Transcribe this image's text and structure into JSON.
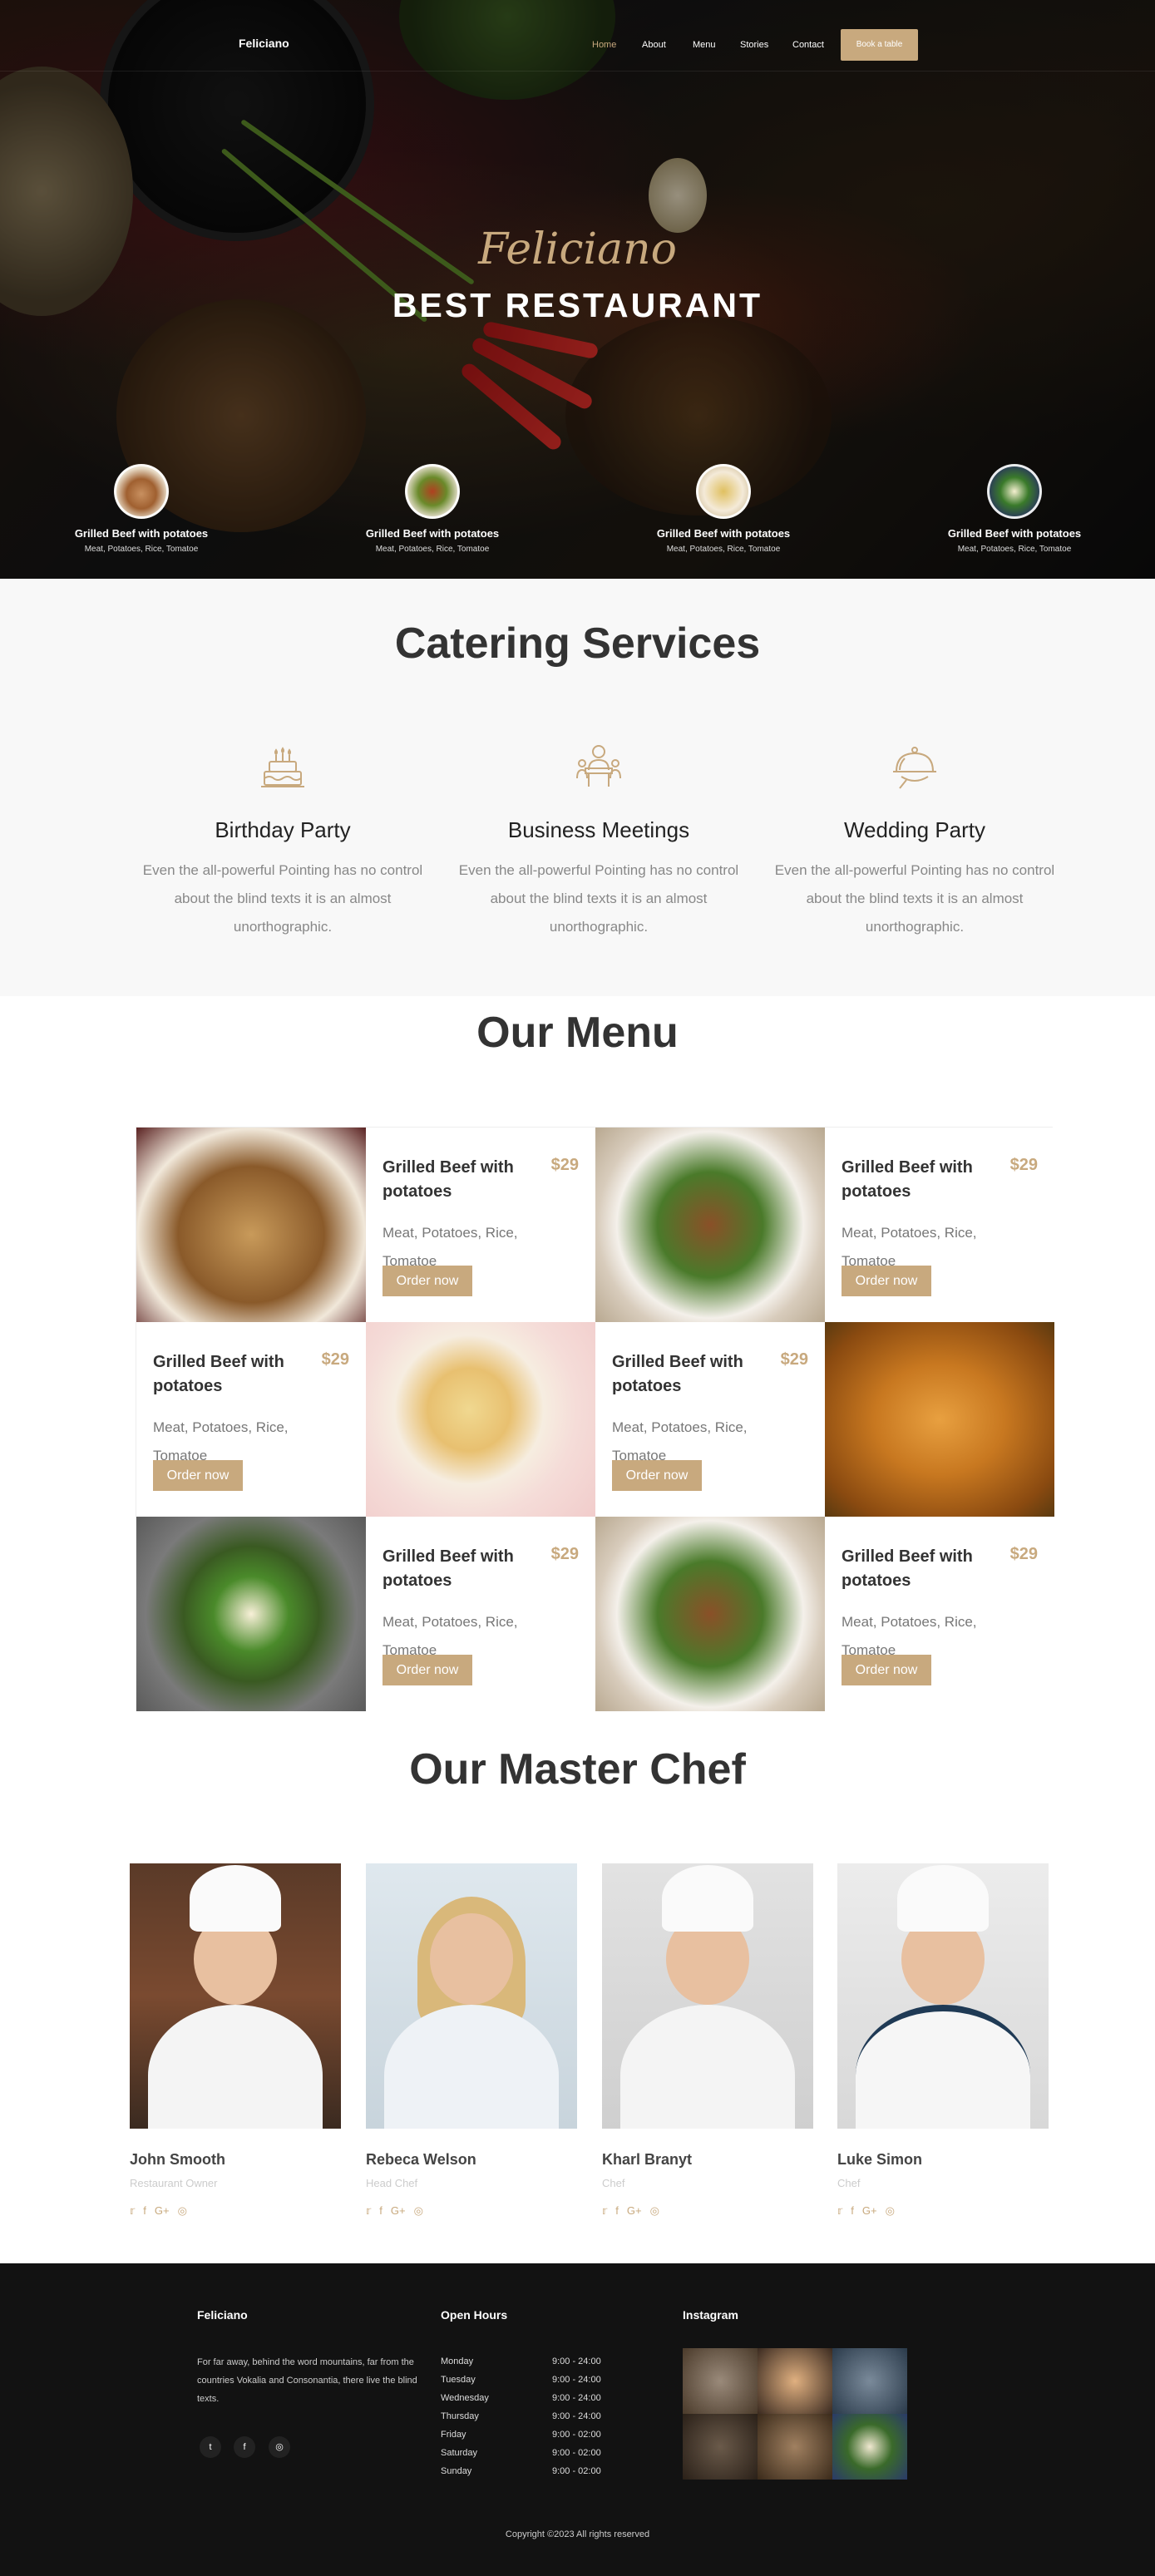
{
  "nav": {
    "brand": "Feliciano",
    "links": [
      "Home",
      "About",
      "Menu",
      "Stories",
      "Contact"
    ],
    "cta": "Book a table"
  },
  "hero": {
    "script": "Feliciano",
    "title": "BEST RESTAURANT",
    "features": [
      {
        "title": "Grilled Beef with potatoes",
        "subtitle": "Meat, Potatoes, Rice, Tomatoe"
      },
      {
        "title": "Grilled Beef with potatoes",
        "subtitle": "Meat, Potatoes, Rice, Tomatoe"
      },
      {
        "title": "Grilled Beef with potatoes",
        "subtitle": "Meat, Potatoes, Rice, Tomatoe"
      },
      {
        "title": "Grilled Beef with potatoes",
        "subtitle": "Meat, Potatoes, Rice, Tomatoe"
      }
    ]
  },
  "catering": {
    "title": "Catering Services",
    "services": [
      {
        "name": "Birthday Party",
        "description": "Even the all-powerful Pointing has no control about the blind texts it is an almost unorthographic.",
        "icon": "birthday-cake-icon"
      },
      {
        "name": "Business Meetings",
        "description": "Even the all-powerful Pointing has no control about the blind texts it is an almost unorthographic.",
        "icon": "meeting-icon"
      },
      {
        "name": "Wedding Party",
        "description": "Even the all-powerful Pointing has no control about the blind texts it is an almost unorthographic.",
        "icon": "serving-dish-icon"
      }
    ]
  },
  "menu": {
    "title": "Our Menu",
    "items": [
      {
        "name": "Grilled Beef with potatoes",
        "price": "$29",
        "description": "Meat, Potatoes, Rice, Tomatoe",
        "button": "Order now"
      },
      {
        "name": "Grilled Beef with potatoes",
        "price": "$29",
        "description": "Meat, Potatoes, Rice, Tomatoe",
        "button": "Order now"
      },
      {
        "name": "Grilled Beef with potatoes",
        "price": "$29",
        "description": "Meat, Potatoes, Rice, Tomatoe",
        "button": "Order now"
      },
      {
        "name": "Grilled Beef with potatoes",
        "price": "$29",
        "description": "Meat, Potatoes, Rice, Tomatoe",
        "button": "Order now"
      },
      {
        "name": "Grilled Beef with potatoes",
        "price": "$29",
        "description": "Meat, Potatoes, Rice, Tomatoe",
        "button": "Order now"
      },
      {
        "name": "Grilled Beef with potatoes",
        "price": "$29",
        "description": "Meat, Potatoes, Rice, Tomatoe",
        "button": "Order now"
      }
    ]
  },
  "chefs": {
    "title": "Our Master Chef",
    "members": [
      {
        "name": "John Smooth",
        "role": "Restaurant Owner"
      },
      {
        "name": "Rebeca Welson",
        "role": "Head Chef"
      },
      {
        "name": "Kharl Branyt",
        "role": "Chef"
      },
      {
        "name": "Luke Simon",
        "role": "Chef"
      }
    ],
    "social": [
      "twitter-icon",
      "facebook-icon",
      "google-plus-icon",
      "instagram-icon"
    ]
  },
  "footer": {
    "brand": "Feliciano",
    "about": "For far away, behind the word mountains, far from the countries Vokalia and Consonantia, there live the blind texts.",
    "hours_title": "Open Hours",
    "hours": [
      {
        "day": "Monday",
        "time": "9:00 - 24:00"
      },
      {
        "day": "Tuesday",
        "time": "9:00 - 24:00"
      },
      {
        "day": "Wednesday",
        "time": "9:00 - 24:00"
      },
      {
        "day": "Thursday",
        "time": "9:00 - 24:00"
      },
      {
        "day": "Friday",
        "time": "9:00 - 02:00"
      },
      {
        "day": "Saturday",
        "time": "9:00 - 02:00"
      },
      {
        "day": "Sunday",
        "time": "9:00 - 02:00"
      }
    ],
    "instagram_title": "Instagram",
    "copyright": "Copyright ©2023 All rights reserved"
  },
  "colors": {
    "accent": "#c8a97e",
    "dark": "#121212",
    "light_bg": "#f8f8f8"
  }
}
